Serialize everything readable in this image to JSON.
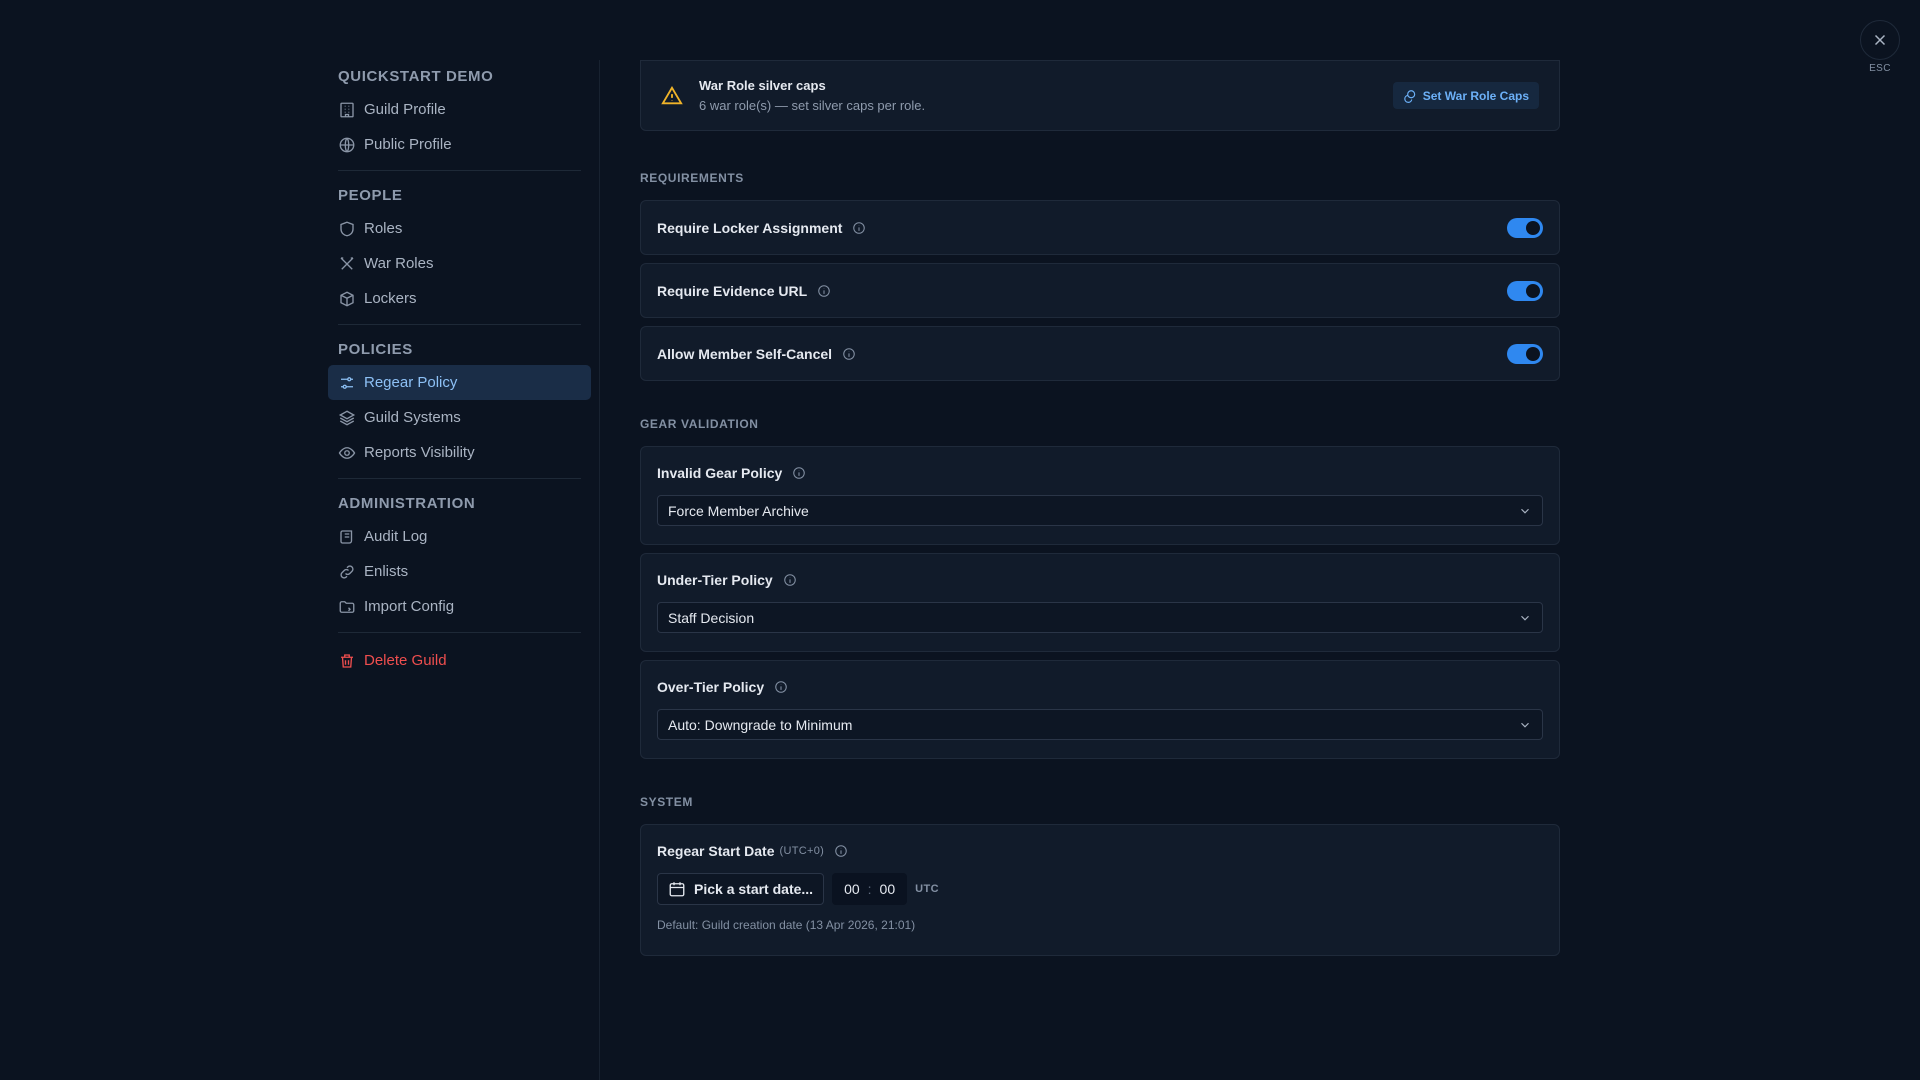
{
  "sidebar": {
    "sections": [
      {
        "title": "QUICKSTART DEMO",
        "items": [
          {
            "label": "Guild Profile",
            "icon": "building-icon"
          },
          {
            "label": "Public Profile",
            "icon": "globe-icon"
          }
        ]
      },
      {
        "title": "PEOPLE",
        "items": [
          {
            "label": "Roles",
            "icon": "shield-icon"
          },
          {
            "label": "War Roles",
            "icon": "crossed-swords-icon"
          },
          {
            "label": "Lockers",
            "icon": "box-icon"
          }
        ]
      },
      {
        "title": "POLICIES",
        "items": [
          {
            "label": "Regear Policy",
            "icon": "sliders-icon",
            "active": true
          },
          {
            "label": "Guild Systems",
            "icon": "layers-icon"
          },
          {
            "label": "Reports Visibility",
            "icon": "eye-icon"
          }
        ]
      },
      {
        "title": "ADMINISTRATION",
        "items": [
          {
            "label": "Audit Log",
            "icon": "scroll-icon"
          },
          {
            "label": "Enlists",
            "icon": "link-icon"
          },
          {
            "label": "Import Config",
            "icon": "folder-icon"
          }
        ]
      }
    ],
    "delete": {
      "label": "Delete Guild",
      "icon": "trash-icon",
      "color": "#ef4e4e"
    }
  },
  "banner": {
    "title": "War Role silver caps",
    "subtitle": "6 war role(s) — set silver caps per role.",
    "button": "Set War Role Caps",
    "icon": "warning-icon"
  },
  "requirements": {
    "label": "REQUIREMENTS",
    "toggles": [
      {
        "label": "Require Locker Assignment",
        "on": true
      },
      {
        "label": "Require Evidence URL",
        "on": true
      },
      {
        "label": "Allow Member Self-Cancel",
        "on": true
      }
    ]
  },
  "gear_validation": {
    "label": "GEAR VALIDATION",
    "selects": [
      {
        "label": "Invalid Gear Policy",
        "value": "Force Member Archive"
      },
      {
        "label": "Under-Tier Policy",
        "value": "Staff Decision"
      },
      {
        "label": "Over-Tier Policy",
        "value": "Auto: Downgrade to Minimum"
      }
    ]
  },
  "system": {
    "label": "SYSTEM",
    "start_date": {
      "label": "Regear Start Date",
      "tz": "(UTC+0)",
      "button": "Pick a start date...",
      "hours": "00",
      "minutes": "00",
      "time_sep": ":",
      "utc": "UTC",
      "hint": "Default: Guild creation date (13 Apr 2026, 21:01)"
    }
  },
  "close": {
    "esc_label": "ESC"
  },
  "colors": {
    "accent": "#2f88f0",
    "warning": "#f0b429",
    "danger": "#ef4e4e",
    "background": "#0b1320"
  }
}
